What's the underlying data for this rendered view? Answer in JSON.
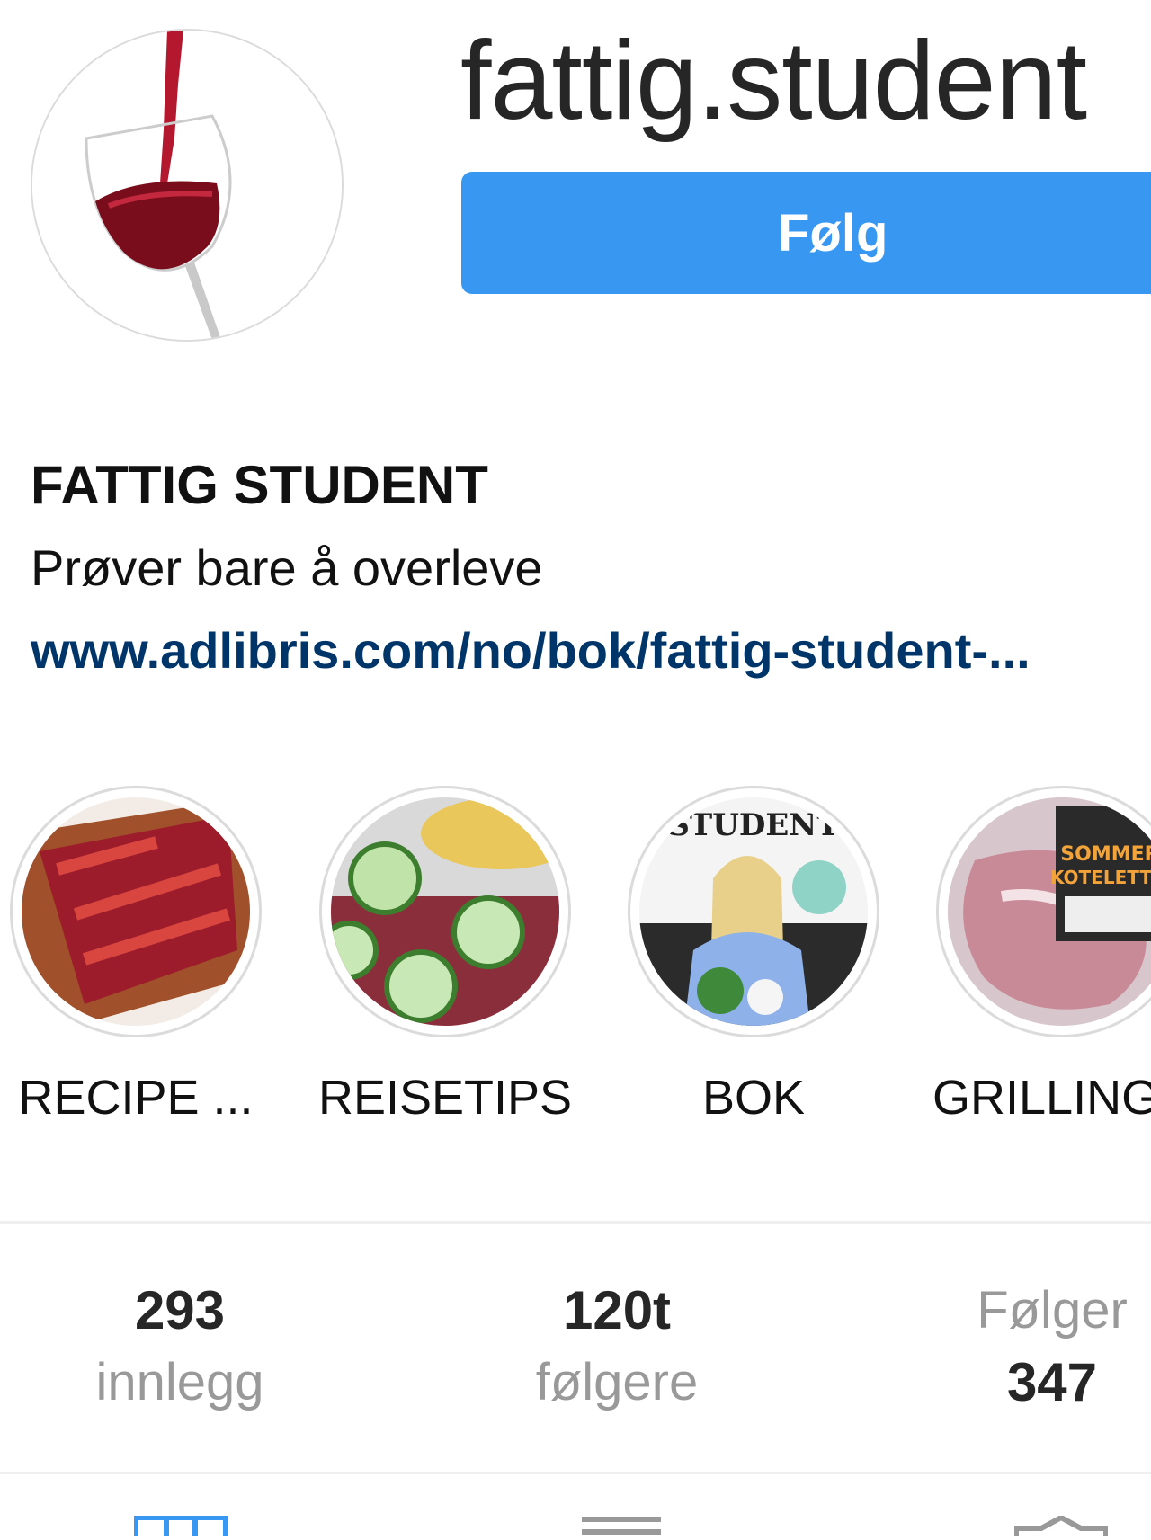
{
  "profile": {
    "username": "fattig.student",
    "follow_label": "Følg",
    "full_name": "FATTIG STUDENT",
    "bio": "Prøver bare å overleve",
    "link": "www.adlibris.com/no/bok/fattig-student-..."
  },
  "highlights": [
    {
      "label": "RECIPE ..."
    },
    {
      "label": "REISETIPS"
    },
    {
      "label": "BOK"
    },
    {
      "label": "GRILLING"
    }
  ],
  "stats": {
    "posts": {
      "value": "293",
      "label": "innlegg"
    },
    "followers": {
      "value": "120t",
      "label": "følgere"
    },
    "following": {
      "label": "Følger",
      "value": "347"
    }
  },
  "tabs": [
    {
      "icon": "grid-icon",
      "active": true
    },
    {
      "icon": "list-icon",
      "active": false
    },
    {
      "icon": "tagged-icon",
      "active": false
    }
  ],
  "colors": {
    "accent": "#3897f0",
    "link": "#003569",
    "muted": "#999999"
  }
}
